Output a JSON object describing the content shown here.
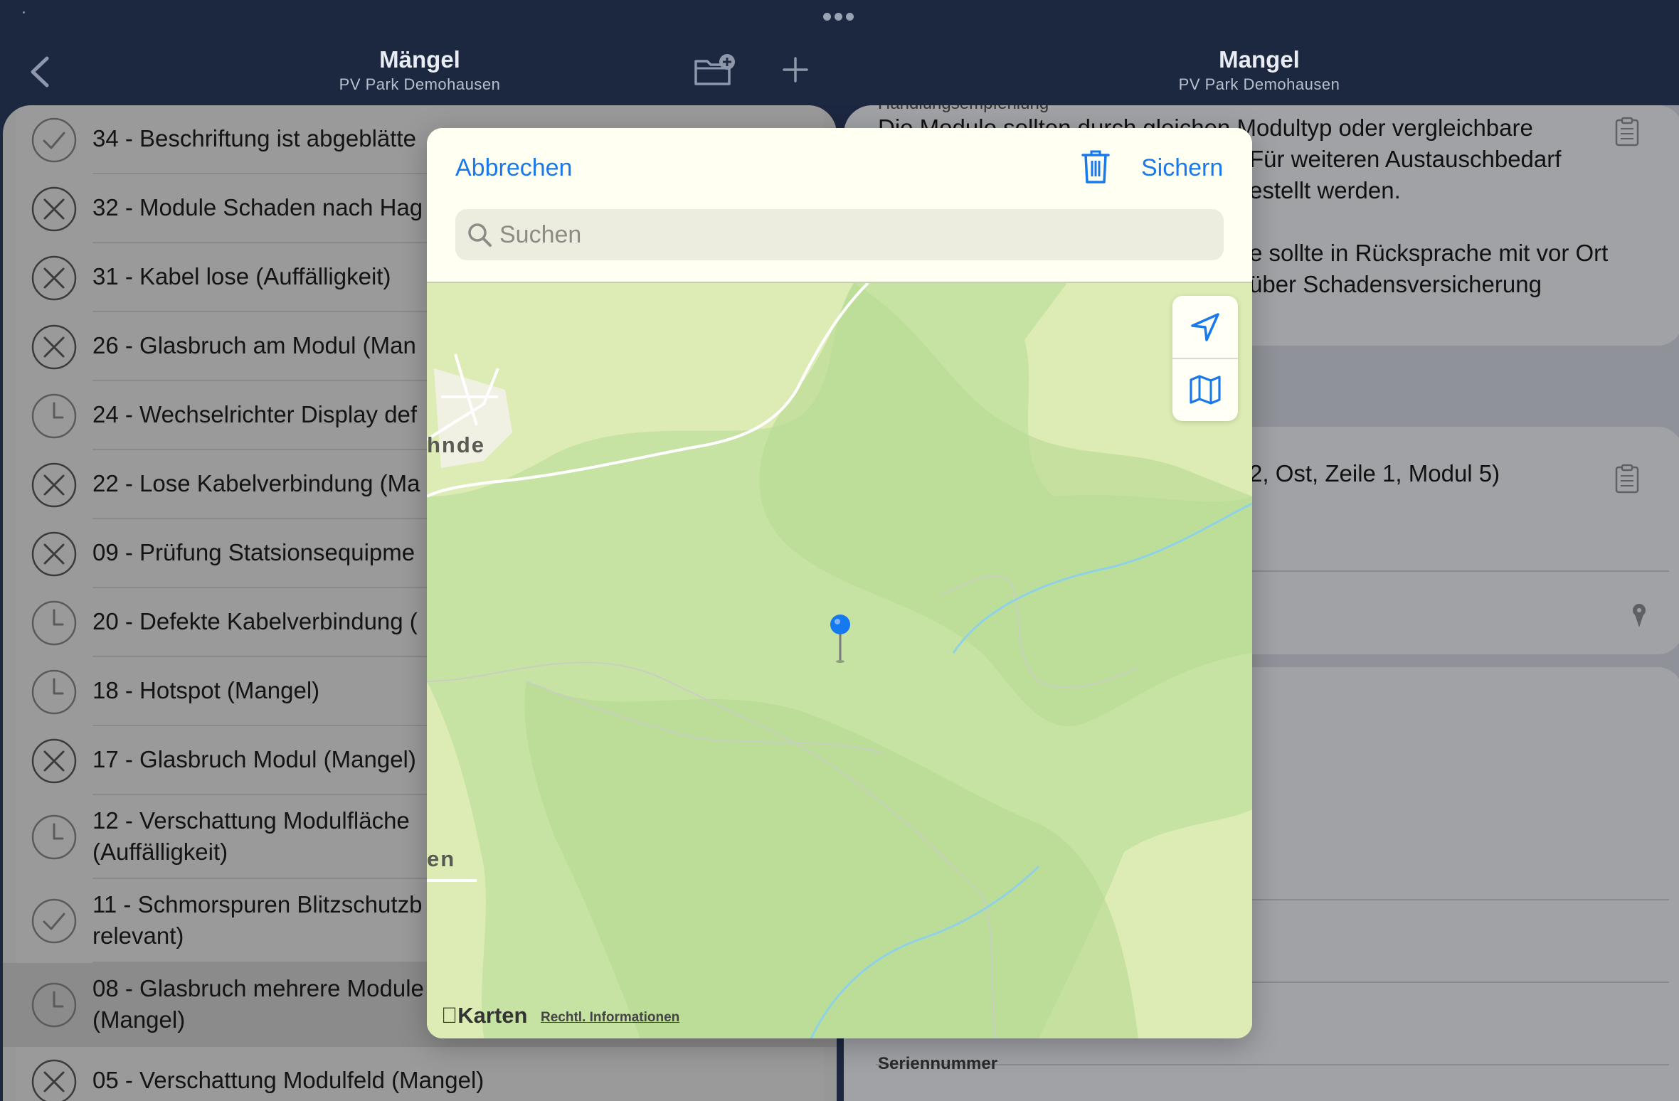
{
  "left_nav": {
    "title": "Mängel",
    "subtitle": "PV Park Demohausen"
  },
  "right_nav": {
    "title": "Mangel",
    "subtitle": "PV Park Demohausen"
  },
  "defects": [
    {
      "label": "34 - Beschriftung ist abgeblätte",
      "status": "done"
    },
    {
      "label": "32 - Module Schaden nach Hag",
      "status": "rejected"
    },
    {
      "label": "31 - Kabel lose (Auffälligkeit)",
      "status": "rejected"
    },
    {
      "label": "26 - Glasbruch am Modul (Man",
      "status": "rejected"
    },
    {
      "label": "24 - Wechselrichter Display def",
      "status": "pending"
    },
    {
      "label": "22 - Lose Kabelverbindung (Ma",
      "status": "rejected"
    },
    {
      "label": "09 - Prüfung Statsionsequipme",
      "status": "rejected"
    },
    {
      "label": "20 - Defekte Kabelverbindung (",
      "status": "pending"
    },
    {
      "label": "18 - Hotspot (Mangel)",
      "status": "pending"
    },
    {
      "label": "17 - Glasbruch Modul (Mangel)",
      "status": "rejected"
    },
    {
      "label": "12 - Verschattung Modulfläche",
      "label2": "(Auffälligkeit)",
      "status": "pending"
    },
    {
      "label": "11 - Schmorspuren Blitzschutzb",
      "label2": "relevant)",
      "status": "done"
    },
    {
      "label": "08 - Glasbruch mehrere Module",
      "label2": "(Mangel)",
      "status": "pending",
      "selected": true
    },
    {
      "label": "05 - Verschattung Modulfeld (Mangel)",
      "status": "rejected"
    }
  ],
  "detail": {
    "header_cut": "Handlungsempfehlung",
    "recommendation_lines": [
      "Die Module sollten durch gleichen Modultyp oder vergleichbare",
      "Für weiteren Austauschbedarf",
      "estellt werden.",
      "",
      "e sollte in Rücksprache mit vor Ort",
      "über Schadensversicherung"
    ],
    "location_text": "2, Ost, Zeile 1, Modul 5)",
    "serial_label": "Seriennummer"
  },
  "modal": {
    "cancel_label": "Abbrechen",
    "save_label": "Sichern",
    "search_placeholder": "Suchen",
    "place_top": "hnde",
    "place_bottom": "en",
    "brand": "Karten",
    "legal": "Rechtl. Informationen"
  },
  "colors": {
    "accent": "#1a79ea",
    "nav_bg": "#1c2740",
    "map_green": "#c4e2a2"
  }
}
